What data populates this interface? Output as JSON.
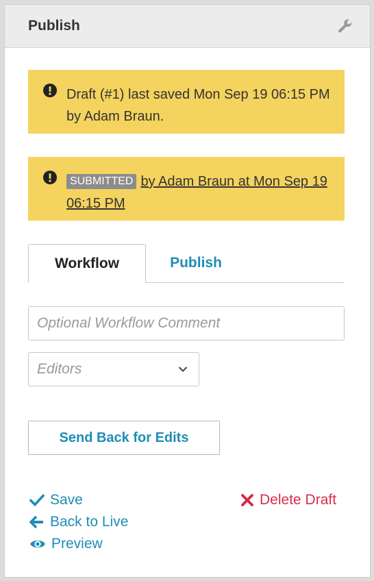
{
  "header": {
    "title": "Publish",
    "settings_icon": "wrench-icon"
  },
  "alerts": [
    {
      "icon": "warning-icon",
      "text": "Draft (#1) last saved Mon Sep 19 06:15 PM by Adam Braun."
    },
    {
      "icon": "warning-icon",
      "badge": "SUBMITTED",
      "link_text": "by Adam Braun at Mon Sep 19 06:15 PM"
    }
  ],
  "tabs": [
    {
      "label": "Workflow",
      "active": true
    },
    {
      "label": "Publish",
      "active": false
    }
  ],
  "workflow": {
    "comment_placeholder": "Optional Workflow Comment",
    "comment_value": "",
    "editors_select": {
      "selected": "Editors",
      "icon": "chevron-down-icon"
    },
    "send_back_label": "Send Back for Edits"
  },
  "actions": {
    "save": {
      "label": "Save",
      "icon": "check-icon"
    },
    "back_to_live": {
      "label": "Back to Live",
      "icon": "arrow-left-icon"
    },
    "preview": {
      "label": "Preview",
      "icon": "eye-icon"
    },
    "delete_draft": {
      "label": "Delete Draft",
      "icon": "x-icon"
    }
  },
  "colors": {
    "alert_bg": "#f4d35e",
    "link_blue": "#1f8db5",
    "delete_red": "#d62e48",
    "badge_gray": "#8c8c8c",
    "header_bg": "#ececec"
  }
}
